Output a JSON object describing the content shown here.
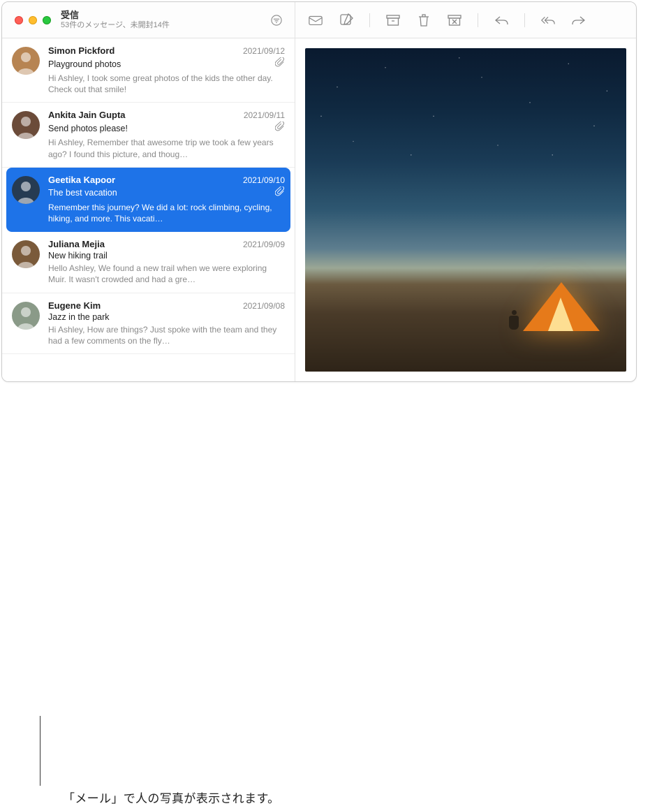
{
  "header": {
    "mailbox_title": "受信",
    "mailbox_sub": "53件のメッセージ、未開封14件"
  },
  "messages": [
    {
      "sender": "Simon Pickford",
      "date": "2021/09/12",
      "subject": "Playground photos",
      "has_attachment": true,
      "preview": "Hi Ashley, I took some great photos of the kids the other day. Check out that smile!",
      "avatar_bg": "#b78452"
    },
    {
      "sender": "Ankita Jain Gupta",
      "date": "2021/09/11",
      "subject": "Send photos please!",
      "has_attachment": true,
      "preview": "Hi Ashley, Remember that awesome trip we took a few years ago? I found this picture, and thoug…",
      "avatar_bg": "#6b4b39"
    },
    {
      "sender": "Geetika Kapoor",
      "date": "2021/09/10",
      "subject": "The best vacation",
      "has_attachment": true,
      "preview": "Remember this journey? We did a lot: rock climbing, cycling, hiking, and more. This vacati…",
      "avatar_bg": "#263b52",
      "selected": true
    },
    {
      "sender": "Juliana Mejia",
      "date": "2021/09/09",
      "subject": "New hiking trail",
      "has_attachment": false,
      "preview": "Hello Ashley, We found a new trail when we were exploring Muir. It wasn't crowded and had a gre…",
      "avatar_bg": "#7a5a3a"
    },
    {
      "sender": "Eugene Kim",
      "date": "2021/09/08",
      "subject": "Jazz in the park",
      "has_attachment": false,
      "preview": "Hi Ashley, How are things? Just spoke with the team and they had a few comments on the fly…",
      "avatar_bg": "#8a9a88"
    }
  ],
  "callout": {
    "text": "「メール」で人の写真が表示されます。"
  }
}
